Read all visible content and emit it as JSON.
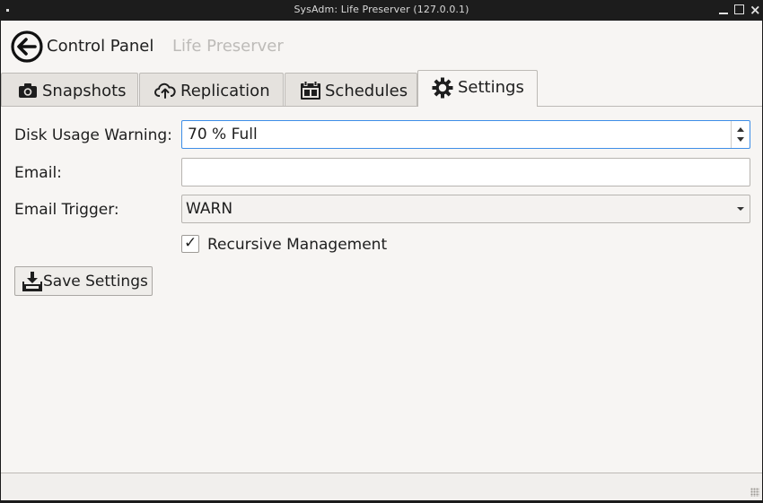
{
  "window": {
    "title": "SysAdm: Life Preserver (127.0.0.1)"
  },
  "header": {
    "back_label": "Control Panel",
    "app_label": "Life Preserver"
  },
  "tabs": [
    {
      "label": "Snapshots",
      "icon": "camera-icon",
      "active": false
    },
    {
      "label": "Replication",
      "icon": "cloud-upload-icon",
      "active": false
    },
    {
      "label": "Schedules",
      "icon": "calendar-icon",
      "active": false
    },
    {
      "label": "Settings",
      "icon": "gear-icon",
      "active": true
    }
  ],
  "settings": {
    "disk_usage_label": "Disk Usage Warning:",
    "disk_usage_value": "70 % Full",
    "email_label": "Email:",
    "email_value": "",
    "trigger_label": "Email Trigger:",
    "trigger_value": "WARN",
    "recursive_label": "Recursive Management",
    "recursive_checked": true,
    "check_mark": "✓",
    "save_label": "Save Settings"
  },
  "colors": {
    "accent_focus": "#3d8ee8",
    "window_bg": "#f7f5f3",
    "titlebar_bg": "#1c1c1c"
  }
}
